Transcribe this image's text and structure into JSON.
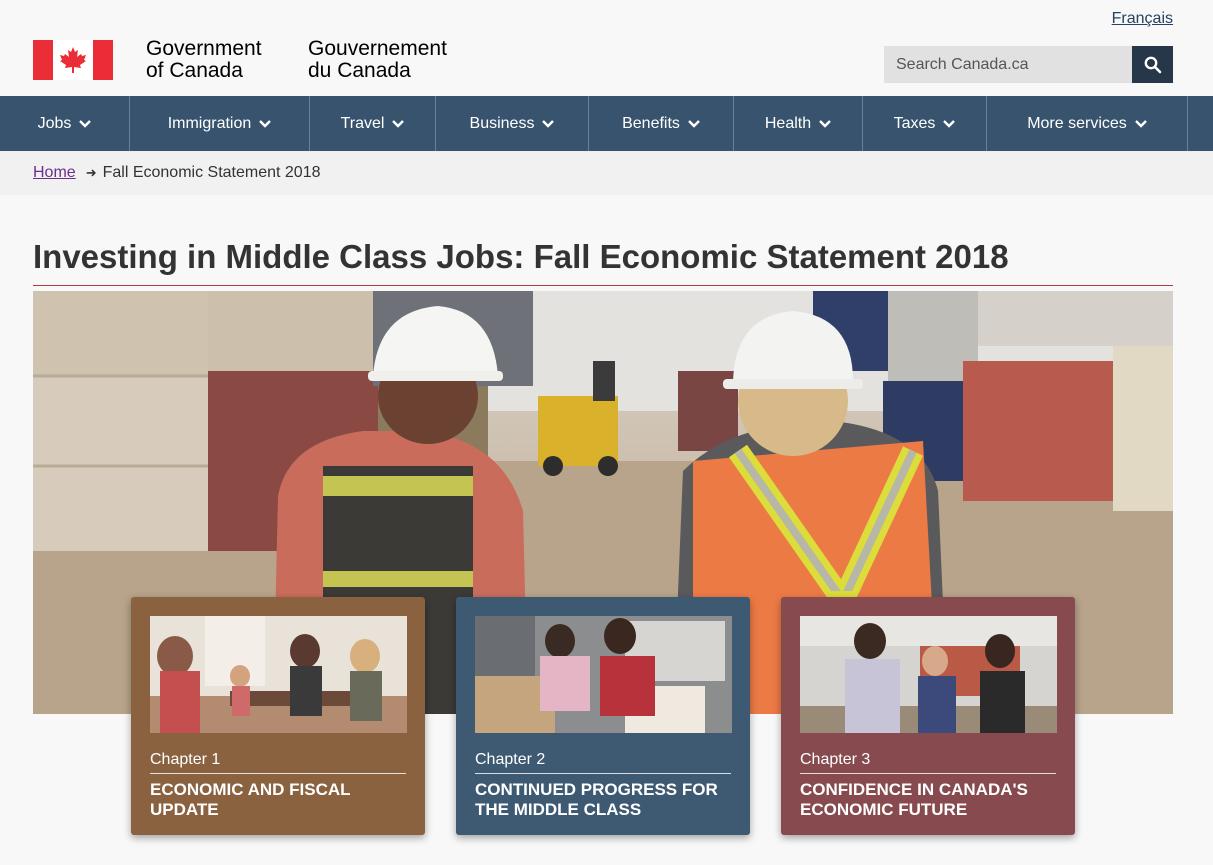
{
  "header": {
    "language_link": "Français",
    "brand_en_line1": "Government",
    "brand_en_line2": "of Canada",
    "brand_fr_line1": "Gouvernement",
    "brand_fr_line2": "du Canada",
    "search_placeholder": "Search Canada.ca",
    "search_icon": "search-icon",
    "flag_icon": "canada-flag-icon"
  },
  "nav": {
    "items": [
      {
        "label": "Jobs"
      },
      {
        "label": "Immigration"
      },
      {
        "label": "Travel"
      },
      {
        "label": "Business"
      },
      {
        "label": "Benefits"
      },
      {
        "label": "Health"
      },
      {
        "label": "Taxes"
      },
      {
        "label": "More services"
      }
    ]
  },
  "breadcrumb": {
    "home": "Home",
    "current": "Fall Economic Statement 2018"
  },
  "main": {
    "title": "Investing in Middle Class Jobs: Fall Economic Statement 2018"
  },
  "cards": [
    {
      "chapter": "Chapter 1",
      "title": "Economic and Fiscal Update",
      "color": "#8a6240"
    },
    {
      "chapter": "Chapter 2",
      "title": "Continued Progress for the Middle Class",
      "color": "#3e5a73"
    },
    {
      "chapter": "Chapter 3",
      "title": "Confidence in Canada's Economic Future",
      "color": "#874a4e"
    }
  ],
  "colors": {
    "nav_bg": "#38536d",
    "search_button": "#26374a",
    "flag_red": "#eb2d37",
    "title_rule": "#af3c43"
  }
}
